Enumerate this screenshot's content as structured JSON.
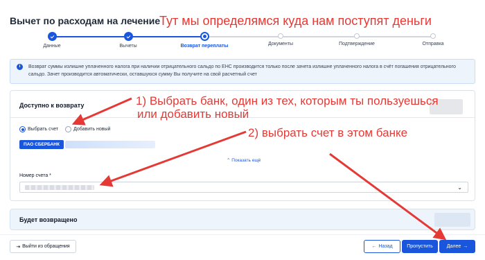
{
  "page": {
    "title": "Вычет по расходам на лечение"
  },
  "annotations": {
    "top": "Тут мы определямся куда нам поступят деньги",
    "step1_line1": "1) Выбрать банк, один из тех, которым ты пользуешься",
    "step1_line2": "или добавить новый",
    "step2": "2) выбрать счет в этом банке",
    "color": "#e53935"
  },
  "stepper": {
    "steps": [
      {
        "label": "Данные",
        "state": "done"
      },
      {
        "label": "Вычеты",
        "state": "done"
      },
      {
        "label": "Возврат переплаты",
        "state": "current"
      },
      {
        "label": "Документы",
        "state": "future"
      },
      {
        "label": "Подтверждение",
        "state": "future"
      },
      {
        "label": "Отправка",
        "state": "future"
      }
    ]
  },
  "info": {
    "text": "Возврат суммы излишне уплаченного налога при наличии отрицательного сальдо по ЕНС производится только после зачета излишне уплаченного налога в счёт погашения отрицательного сальдо. Зачет производится автоматически, оставшуюся сумму Вы получите на свой расчетный счет",
    "icon": "info-icon"
  },
  "available": {
    "title": "Доступно к возврату",
    "radio_select_account": "Выбрать счет",
    "radio_add_new": "Добавить новый",
    "selected_option": "Выбрать счет",
    "bank_chip": "ПАО СБЕРБАНК",
    "show_more": "Показать ещё",
    "account_label": "Номер счета *"
  },
  "returned": {
    "title": "Будет возвращено"
  },
  "footer": {
    "exit_label": "Выйти из обращения",
    "back_label": "Назад",
    "skip_label": "Пропустить",
    "next_label": "Далее"
  },
  "colors": {
    "accent": "#1a56db",
    "info_bg": "#eef4fc"
  }
}
